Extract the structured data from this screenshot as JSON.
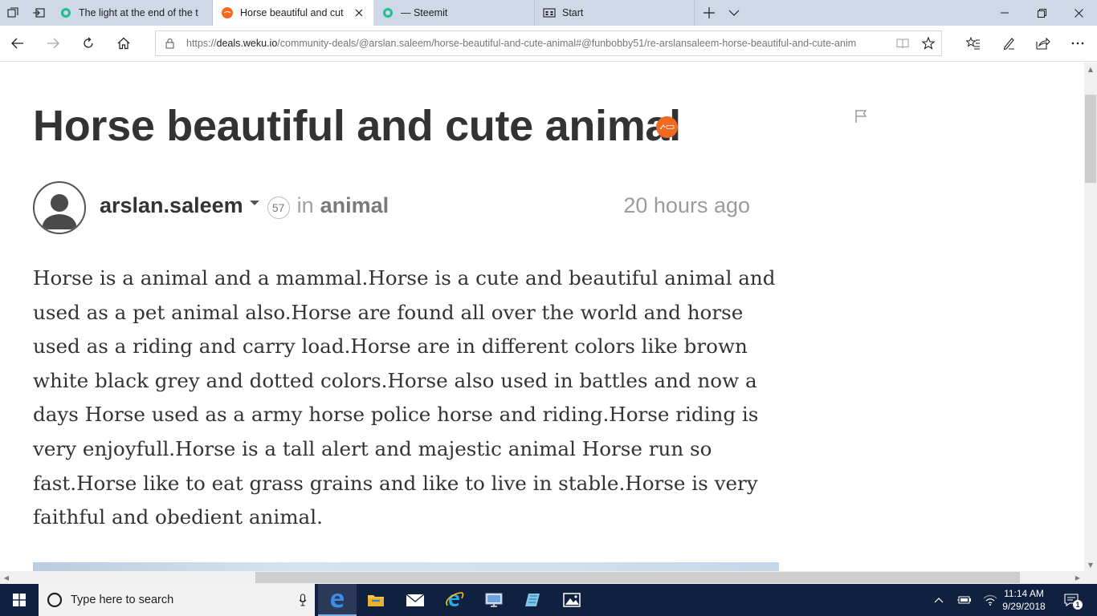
{
  "browser": {
    "tabs": [
      {
        "title": "The light at the end of the t",
        "active": false,
        "favicon": "steemit-icon"
      },
      {
        "title": "Horse beautiful and cut",
        "active": true,
        "favicon": "weku-icon"
      },
      {
        "title": "— Steemit",
        "active": false,
        "favicon": "steemit-icon"
      },
      {
        "title": "Start",
        "active": false,
        "favicon": "start-page-icon"
      }
    ],
    "url_prefix": "https://",
    "url_host": "deals.weku.io",
    "url_path": "/community-deals/@arslan.saleem/horse-beautiful-and-cute-animal#@funbobby51/re-arslansaleem-horse-beautiful-and-cute-anim"
  },
  "post": {
    "title": "Horse beautiful and cute animal",
    "author": "arslan.saleem",
    "reputation": "57",
    "in_word": "in",
    "category": "animal",
    "time_ago": "20 hours ago",
    "body_lines": [
      "Horse is a animal and a mammal.Horse is a cute and beautiful animal and",
      "used as a pet animal also.Horse are found all over the world and horse",
      "used as a riding and carry load.Horse are in different colors like brown",
      "white black grey and dotted colors.Horse also used in battles and now a",
      "days Horse used as a army horse police horse and riding.Horse riding is",
      "very enjoyfull.Horse is a tall alert and majestic animal Horse run so",
      "fast.Horse like to eat grass grains and like to live in stable.Horse is very",
      "faithful and obedient animal."
    ]
  },
  "taskbar": {
    "search_placeholder": "Type here to search",
    "time": "11:14 AM",
    "date": "9/29/2018",
    "notification_count": "1"
  },
  "colors": {
    "weku_orange": "#f26a21",
    "taskbar_bg": "#10213f",
    "tabbar_bg": "#cfd8e6",
    "text_dark": "#333333"
  }
}
